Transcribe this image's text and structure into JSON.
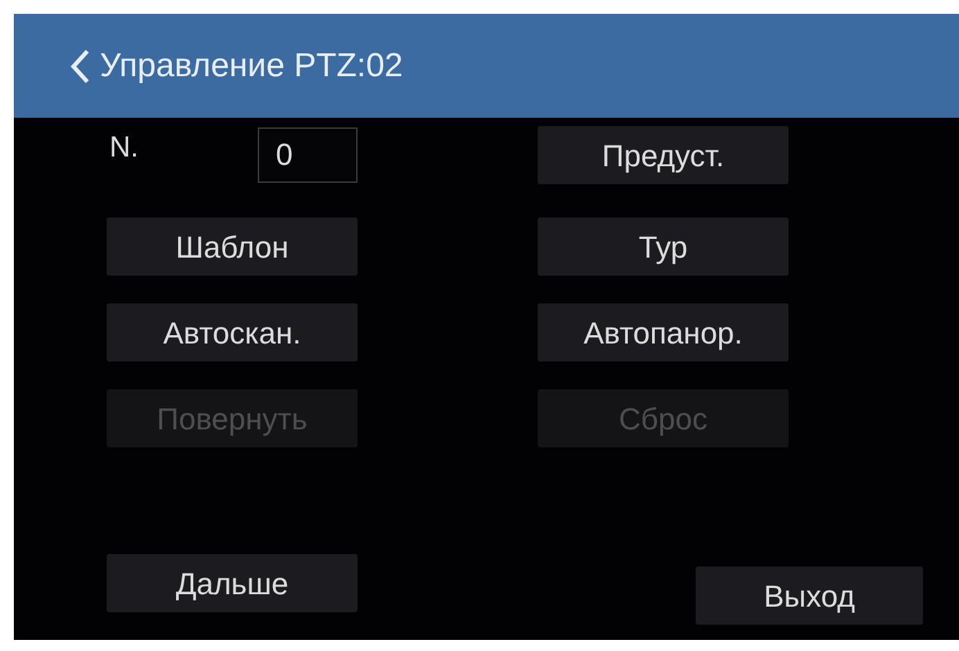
{
  "header": {
    "title": "Управление PTZ:02"
  },
  "controls": [
    {
      "kind": "field",
      "label": "N.",
      "value": "0"
    },
    {
      "kind": "button",
      "label": "Предуст.",
      "disabled": false
    },
    {
      "kind": "button",
      "label": "Шаблон",
      "disabled": false
    },
    {
      "kind": "button",
      "label": "Тур",
      "disabled": false
    },
    {
      "kind": "button",
      "label": "Автоскан.",
      "disabled": false
    },
    {
      "kind": "button",
      "label": "Автопанор.",
      "disabled": false
    },
    {
      "kind": "button",
      "label": "Повернуть",
      "disabled": true
    },
    {
      "kind": "button",
      "label": "Сброс",
      "disabled": true
    }
  ],
  "footer": [
    {
      "label": "Дальше",
      "disabled": false
    },
    {
      "label": "Выход",
      "disabled": false
    }
  ]
}
